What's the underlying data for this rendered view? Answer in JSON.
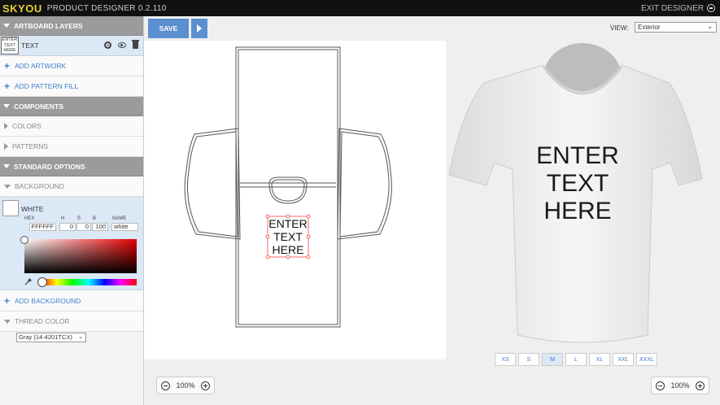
{
  "app": {
    "brand": "SKYOU",
    "title": "PRODUCT DESIGNER",
    "version": "0.2.110",
    "exit_label": "EXIT DESIGNER"
  },
  "sidebar": {
    "artboard_layers": "ARTBOARD LAYERS",
    "layer": {
      "thumb_lines": [
        "ENTER",
        "TEXT",
        "HERE"
      ],
      "name": "TEXT"
    },
    "add_artwork": "ADD ARTWORK",
    "add_pattern_fill": "ADD PATTERN FILL",
    "components": "COMPONENTS",
    "colors": "COLORS",
    "patterns": "PATTERNS",
    "standard_options": "STANDARD OPTIONS",
    "background": "BACKGROUND",
    "bg": {
      "swatch_name": "WHITE",
      "hex_label": "HEX",
      "h_label": "H",
      "s_label": "S",
      "b_label": "B",
      "name_label": "NAME",
      "hex": "FFFFFF",
      "h": "0",
      "s": "0",
      "b": "100",
      "name": "white"
    },
    "add_background": "ADD BACKGROUND",
    "thread_color": "THREAD COLOR",
    "thread_value": "Gray (14-4201TCX)"
  },
  "toolbar": {
    "save": "SAVE",
    "view_label": "VIEW:",
    "view_value": "Exterior"
  },
  "artboard": {
    "text_lines": [
      "ENTER",
      "TEXT",
      "HERE"
    ]
  },
  "preview": {
    "text_lines": [
      "ENTER",
      "TEXT",
      "HERE"
    ],
    "sizes": [
      "XS",
      "S",
      "M",
      "L",
      "XL",
      "XXL",
      "XXXL"
    ],
    "active_size": "M"
  },
  "zoom": {
    "left": "100%",
    "right": "100%"
  }
}
